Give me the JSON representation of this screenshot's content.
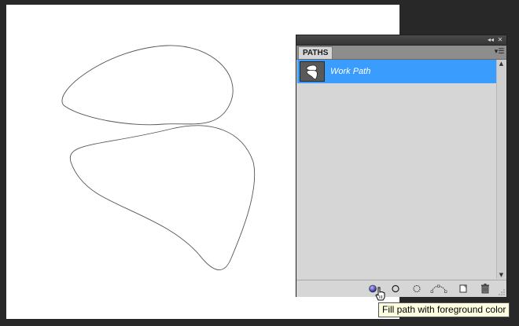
{
  "canvas": {
    "background": "#ffffff",
    "path_stroke": "#555555",
    "shape": "work-path-outline"
  },
  "panel": {
    "topbar": {
      "collapse_icon": "double-chevron-left-icon",
      "close_icon": "close-icon",
      "collapse_glyph": "◂◂",
      "close_glyph": "✕"
    },
    "tab_label": "PATHS",
    "menu_icon": "panel-menu-icon",
    "paths": [
      {
        "name": "Work Path",
        "selected": true,
        "thumbnail_icon": "path-thumbnail-icon"
      }
    ],
    "selection_color": "#3a9cfd",
    "footer_buttons": [
      {
        "name": "fill-path-button",
        "icon": "fill-path-icon"
      },
      {
        "name": "stroke-path-button",
        "icon": "stroke-path-icon"
      },
      {
        "name": "load-as-selection-button",
        "icon": "selection-icon"
      },
      {
        "name": "make-work-path-button",
        "icon": "work-path-icon"
      },
      {
        "name": "new-path-button",
        "icon": "new-path-icon"
      },
      {
        "name": "delete-path-button",
        "icon": "trash-icon"
      }
    ]
  },
  "tooltip": {
    "text": "Fill path with foreground color"
  },
  "cursor": {
    "icon": "hand-pointer-icon"
  }
}
